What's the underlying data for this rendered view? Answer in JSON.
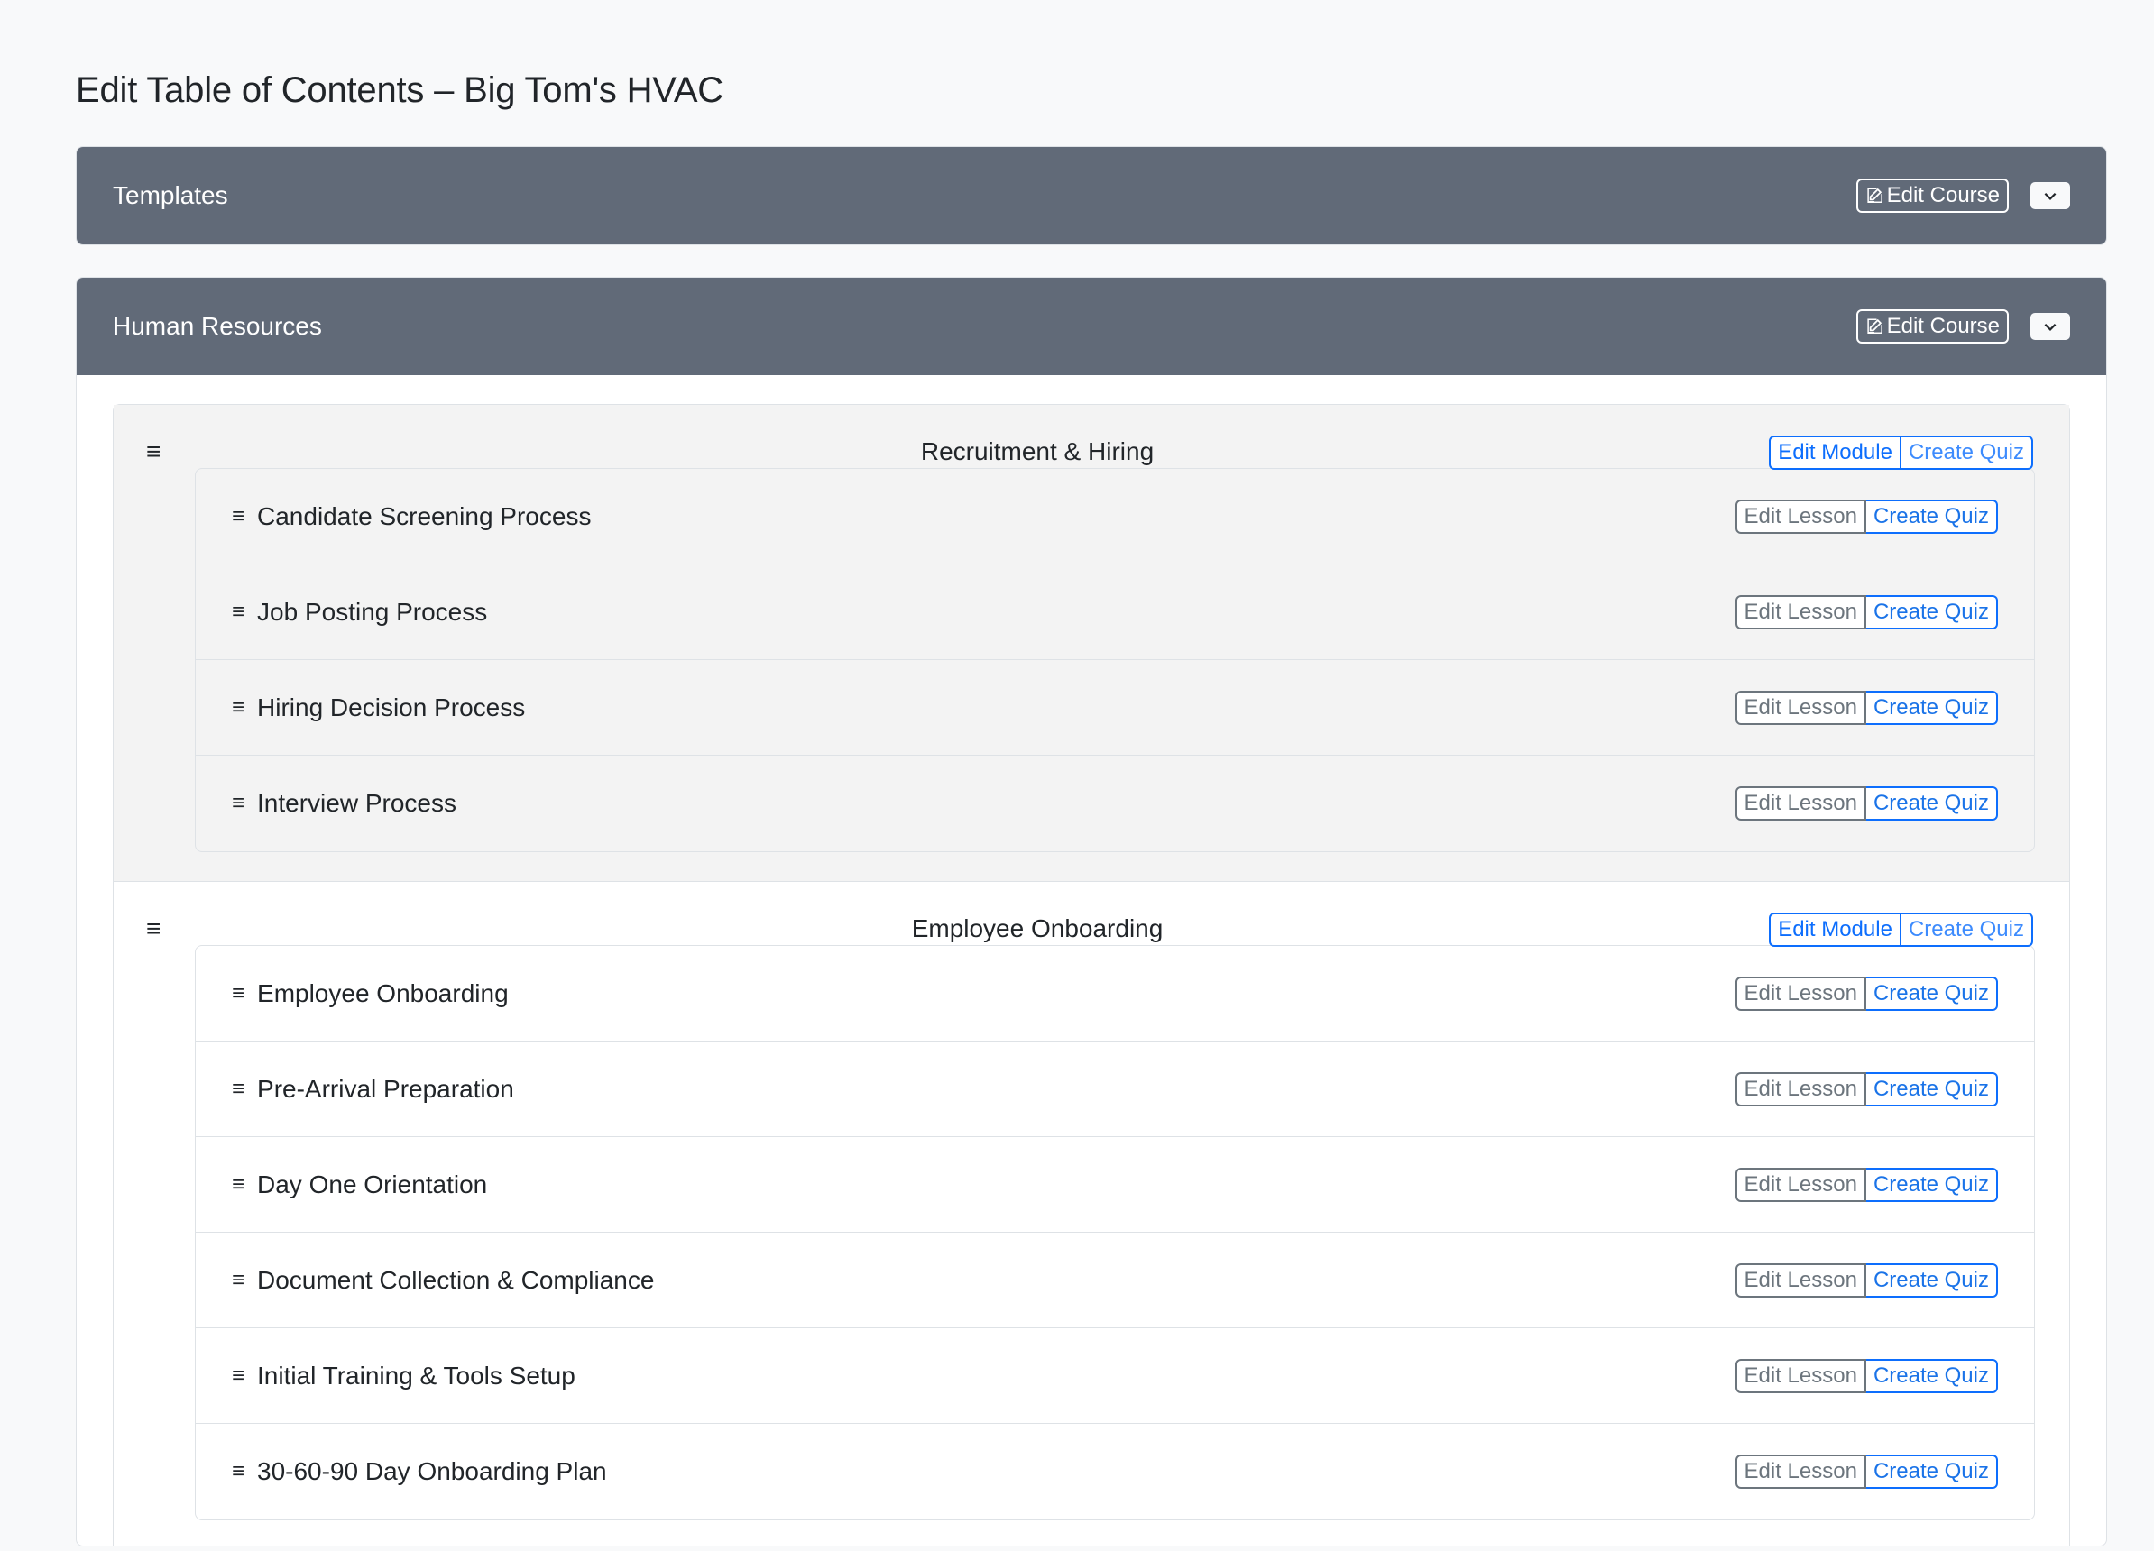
{
  "page": {
    "title": "Edit Table of Contents – Big Tom's HVAC"
  },
  "labels": {
    "edit_course": "Edit Course",
    "edit_module": "Edit Module",
    "edit_lesson": "Edit Lesson",
    "create_quiz": "Create Quiz"
  },
  "courses": [
    {
      "title": "Templates"
    },
    {
      "title": "Human Resources"
    }
  ],
  "modules": [
    {
      "title": "Recruitment & Hiring",
      "lessons": [
        "Candidate Screening Process",
        "Job Posting Process",
        "Hiring Decision Process",
        "Interview Process"
      ]
    },
    {
      "title": "Employee Onboarding",
      "lessons": [
        "Employee Onboarding",
        "Pre-Arrival Preparation",
        "Day One Orientation",
        "Document Collection & Compliance",
        "Initial Training & Tools Setup",
        "30-60-90 Day Onboarding Plan"
      ]
    }
  ],
  "colors": {
    "header_bg": "#616a78",
    "primary": "#0d6efd",
    "secondary": "#6c757d",
    "active_module_bg": "#f3f3f3"
  }
}
